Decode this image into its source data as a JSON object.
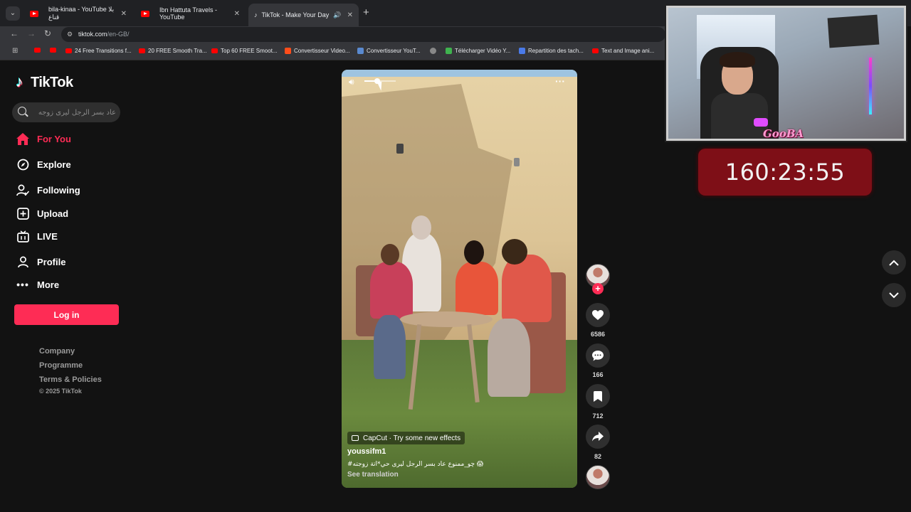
{
  "browser": {
    "tabs": [
      {
        "label": "bila-kinaa - YouTube بلا قناع"
      },
      {
        "label": "Ibn Hattuta Travels - YouTube"
      },
      {
        "label": "TikTok - Make Your Day"
      }
    ],
    "url_host": "tiktok.com",
    "url_path": "/en-GB/",
    "bookmarks": [
      "24 Free Transitions f...",
      "20 FREE Smooth Tra...",
      "Top 60 FREE Smoot...",
      "Convertisseur Video...",
      "Convertisseur YouT...",
      "Télécharger Vidéo Y...",
      "Repartition des tach...",
      "Text and Image ani..."
    ]
  },
  "sidebar": {
    "logo": "TikTok",
    "search_placeholder": "عاد بسر الرجل ليرى زوجه",
    "nav": [
      {
        "label": "For You",
        "icon": "home-icon",
        "active": true
      },
      {
        "label": "Explore",
        "icon": "compass-icon"
      },
      {
        "label": "Following",
        "icon": "following-icon"
      },
      {
        "label": "Upload",
        "icon": "upload-icon"
      },
      {
        "label": "LIVE",
        "icon": "live-icon"
      },
      {
        "label": "Profile",
        "icon": "profile-icon"
      },
      {
        "label": "More",
        "icon": "more-icon"
      }
    ],
    "login_label": "Log in",
    "footer": [
      "Company",
      "Programme",
      "Terms & Policies"
    ],
    "copyright": "© 2025 TikTok"
  },
  "video": {
    "volume_level": 0.4,
    "effect_label": "CapCut · Try some new effects",
    "author": "youssifm1",
    "caption": "#چو_ممنوع  عاد بسر الرجل ليرى حي*اتة زوجته 😱",
    "see_translation": "See translation"
  },
  "actions": {
    "likes": "6586",
    "comments": "166",
    "saves": "712",
    "shares": "82"
  },
  "overlay": {
    "cam_label": "GooBA",
    "timer": "160:23:55"
  },
  "colors": {
    "brand": "#fe2c55",
    "timer_bg": "#7e0f17"
  }
}
